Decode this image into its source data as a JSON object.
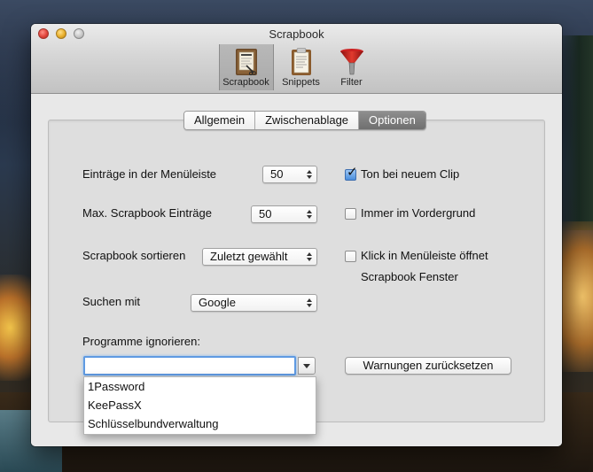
{
  "window": {
    "title": "Scrapbook"
  },
  "toolbar": {
    "items": [
      {
        "label": "Scrapbook",
        "icon": "scrapbook-icon",
        "selected": true
      },
      {
        "label": "Snippets",
        "icon": "snippets-icon",
        "selected": false
      },
      {
        "label": "Filter",
        "icon": "filter-funnel-icon",
        "selected": false
      }
    ]
  },
  "tabs": [
    {
      "label": "Allgemein",
      "active": false
    },
    {
      "label": "Zwischenablage",
      "active": false
    },
    {
      "label": "Optionen",
      "active": true
    }
  ],
  "options": {
    "menu_entries": {
      "label": "Einträge in der Menüleiste",
      "value": "50"
    },
    "max_entries": {
      "label": "Max. Scrapbook Einträge",
      "value": "50"
    },
    "sort": {
      "label": "Scrapbook sortieren",
      "value": "Zuletzt gewählt"
    },
    "search": {
      "label": "Suchen mit",
      "value": "Google"
    },
    "ignore": {
      "label": "Programme ignorieren:",
      "input_value": "",
      "dropdown_items": [
        "1Password",
        "KeePassX",
        "Schlüsselbundverwaltung"
      ]
    },
    "sound_new_clip": {
      "label": "Ton bei neuem Clip",
      "checked": true
    },
    "always_on_top": {
      "label": "Immer im Vordergrund",
      "checked": false
    },
    "menubar_click": {
      "label_line1": "Klick in Menüleiste öffnet",
      "label_line2": "Scrapbook Fenster",
      "checked": false
    },
    "reset_warnings": {
      "label": "Warnungen zurücksetzen"
    }
  },
  "colors": {
    "accent": "#4a8fdd",
    "active_tab": "#7a7a7a",
    "focus_ring": "#5f9ae2"
  }
}
